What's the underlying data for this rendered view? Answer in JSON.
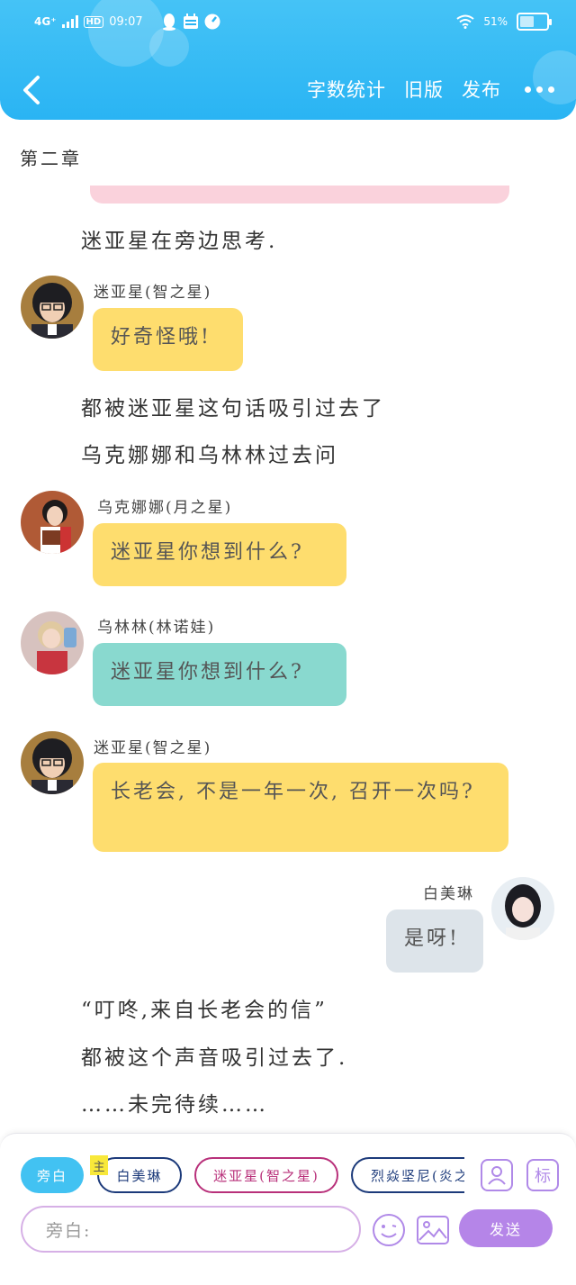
{
  "status_bar": {
    "network": "4G⁺",
    "hd": "HD",
    "time": "09:07",
    "battery": "51%"
  },
  "nav": {
    "word_count": "字数统计",
    "old_version": "旧版",
    "publish": "发布"
  },
  "chapter_title": "第二章",
  "story": {
    "narr1": "迷亚星在旁边思考.",
    "narr2": "都被迷亚星这句话吸引过去了",
    "narr3": "乌克娜娜和乌林林过去问",
    "narr4": "“叮咚,来自长老会的信”",
    "narr5": "都被这个声音吸引过去了.",
    "narr6": "……未完待续……",
    "m1_speaker": "迷亚星(智之星)",
    "m1_text": "好奇怪哦!",
    "m2_speaker": "乌克娜娜(月之星)",
    "m2_text": "迷亚星你想到什么?",
    "m3_speaker": "乌林林(林诺娃)",
    "m3_text": "迷亚星你想到什么?",
    "m4_speaker": "迷亚星(智之星)",
    "m4_text": "长老会, 不是一年一次, 召开一次吗?",
    "m5_speaker": "白美琳",
    "m5_text": "是呀!"
  },
  "composer": {
    "chip_narration": "旁白",
    "main_tag": "主",
    "chip_bai": "白美琳",
    "chip_mi": "迷亚星(智之星)",
    "chip_lie": "烈焱坚尼(炎之",
    "tag_button": "标",
    "input_placeholder": "旁白:",
    "send": "发送"
  },
  "colors": {
    "header": "#2ab4f3",
    "yellow_bubble": "#fedd6e",
    "teal_bubble": "#89d9cf",
    "grey_bubble": "#dde4ea",
    "send": "#b585e8"
  }
}
